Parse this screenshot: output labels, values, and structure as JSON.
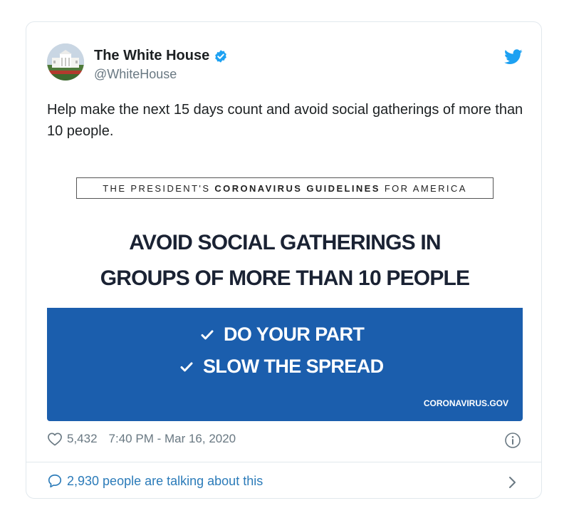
{
  "tweet": {
    "author_name": "The White House",
    "author_handle": "@WhiteHouse",
    "text": "Help make the next 15 days count and avoid social gatherings of more than 10 people.",
    "likes": "5,432",
    "timestamp": "7:40 PM - Mar 16, 2020",
    "talking": "2,930 people are talking about this"
  },
  "graphic": {
    "guideline_prefix": "THE PRESIDENT'S",
    "guideline_bold": "CORONAVIRUS GUIDELINES",
    "guideline_suffix": "FOR AMERICA",
    "headline_line1": "AVOID SOCIAL GATHERINGS IN",
    "headline_line2": "GROUPS OF MORE THAN 10 PEOPLE",
    "check1": "DO YOUR PART",
    "check2": "SLOW THE SPREAD",
    "site": "CORONAVIRUS.GOV"
  },
  "icons": {
    "avatar": "white-house-photo",
    "verified": "verified-badge-icon",
    "logo": "twitter-bird-icon",
    "like": "heart-icon",
    "info": "info-icon",
    "reply": "speech-bubble-icon",
    "more": "chevron-right-icon"
  },
  "colors": {
    "accent": "#1da1f2",
    "link": "#2b7bb9",
    "panel_blue": "#1b5ead",
    "muted": "#697882"
  }
}
